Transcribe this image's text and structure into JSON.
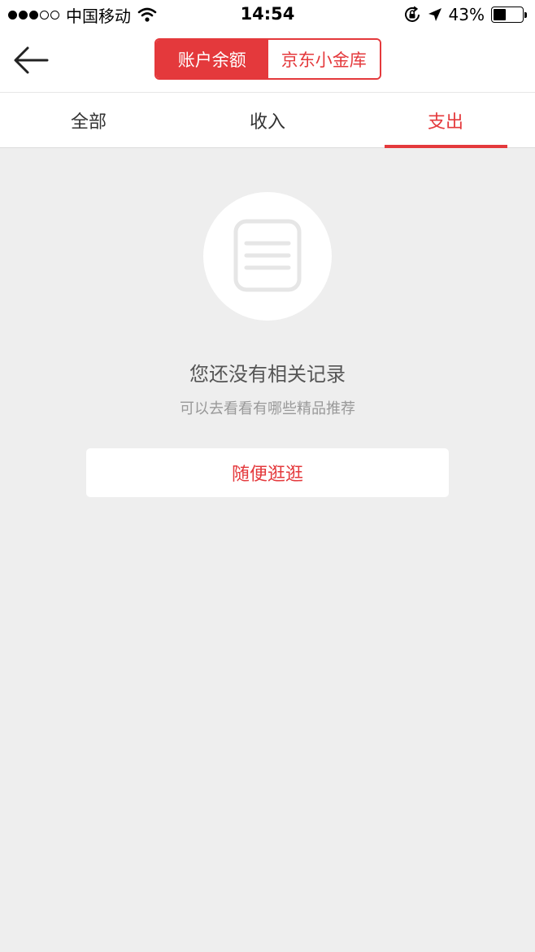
{
  "status_bar": {
    "carrier": "中国移动",
    "time": "14:54",
    "battery_percent": "43%",
    "battery_level": 0.43,
    "signal_bars_filled": 3,
    "signal_bars_total": 5,
    "icons": [
      "signal-dots-icon",
      "wifi-icon",
      "rotation-lock-icon",
      "location-arrow-icon",
      "battery-icon"
    ]
  },
  "nav": {
    "back_icon": "arrow-left-icon",
    "segments": [
      {
        "label": "账户余额",
        "active": true
      },
      {
        "label": "京东小金库",
        "active": false
      }
    ]
  },
  "tabs": [
    {
      "label": "全部",
      "active": false
    },
    {
      "label": "收入",
      "active": false
    },
    {
      "label": "支出",
      "active": true
    }
  ],
  "empty_state": {
    "icon": "document-list-icon",
    "title": "您还没有相关记录",
    "subtitle": "可以去看看有哪些精品推荐",
    "button_label": "随便逛逛"
  },
  "colors": {
    "accent": "#e4393c",
    "background": "#eeeeee",
    "surface": "#ffffff"
  }
}
